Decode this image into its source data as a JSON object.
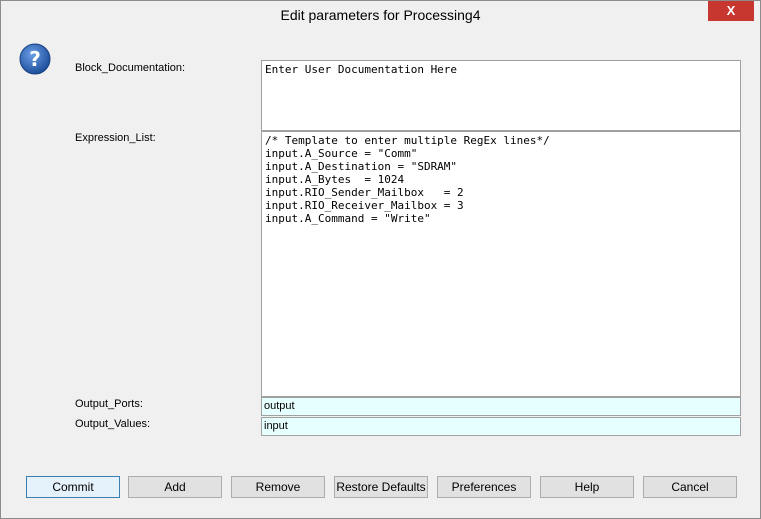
{
  "window": {
    "title": "Edit parameters for Processing4",
    "close_glyph": "X"
  },
  "labels": {
    "block_documentation": "Block_Documentation:",
    "expression_list": "Expression_List:",
    "output_ports": "Output_Ports:",
    "output_values": "Output_Values:"
  },
  "fields": {
    "block_documentation": "Enter User Documentation Here",
    "expression_list": "/* Template to enter multiple RegEx lines*/\ninput.A_Source = \"Comm\"\ninput.A_Destination = \"SDRAM\"\ninput.A_Bytes  = 1024\ninput.RIO_Sender_Mailbox   = 2\ninput.RIO_Receiver_Mailbox = 3\ninput.A_Command = \"Write\"",
    "output_ports": "output",
    "output_values": "input"
  },
  "buttons": {
    "commit": "Commit",
    "add": "Add",
    "remove": "Remove",
    "restore_defaults": "Restore Defaults",
    "preferences": "Preferences",
    "help": "Help",
    "cancel": "Cancel"
  },
  "icons": {
    "help": "question-mark-icon",
    "close": "close-icon"
  },
  "colors": {
    "accent_blue": "#3c6fb7",
    "close_red": "#c7372f",
    "field_cyan": "#e6ffff"
  }
}
